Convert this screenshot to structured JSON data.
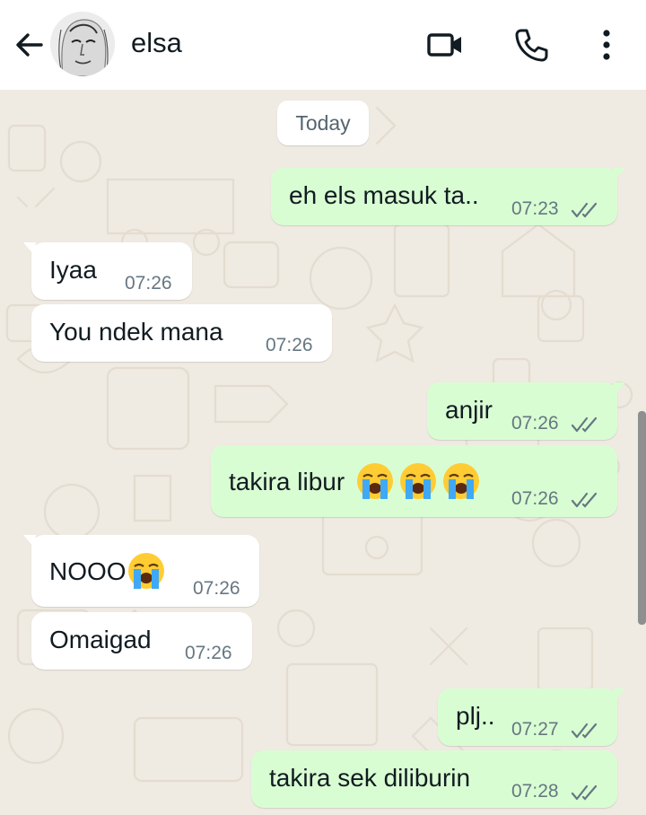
{
  "header": {
    "contact_name": "elsa",
    "back_icon": "arrow-left-icon",
    "video_icon": "video-camera-icon",
    "call_icon": "phone-icon",
    "menu_icon": "more-vertical-icon"
  },
  "date_separator": "Today",
  "messages": [
    {
      "direction": "out",
      "text": "eh els masuk ta..",
      "time": "07:23",
      "status": "read"
    },
    {
      "direction": "in",
      "text": "Iyaa",
      "time": "07:26"
    },
    {
      "direction": "in",
      "text": "You ndek mana",
      "time": "07:26"
    },
    {
      "direction": "out",
      "text": "anjir",
      "time": "07:26",
      "status": "read"
    },
    {
      "direction": "out",
      "text": "takira libur ",
      "emoji": [
        "loudly-crying-face",
        "loudly-crying-face",
        "loudly-crying-face"
      ],
      "time": "07:26",
      "status": "read"
    },
    {
      "direction": "in",
      "text": "NOOO",
      "emoji": [
        "loudly-crying-face"
      ],
      "time": "07:26"
    },
    {
      "direction": "in",
      "text": "Omaigad",
      "time": "07:26"
    },
    {
      "direction": "out",
      "text": "plj..",
      "time": "07:27",
      "status": "read"
    },
    {
      "direction": "out",
      "text": "takira sek diliburin",
      "time": "07:28",
      "status": "read"
    }
  ],
  "colors": {
    "outgoing_bubble": "#d9fdd3",
    "incoming_bubble": "#ffffff",
    "wallpaper": "#efeae2",
    "header": "#ffffff",
    "timestamp": "#667781"
  }
}
